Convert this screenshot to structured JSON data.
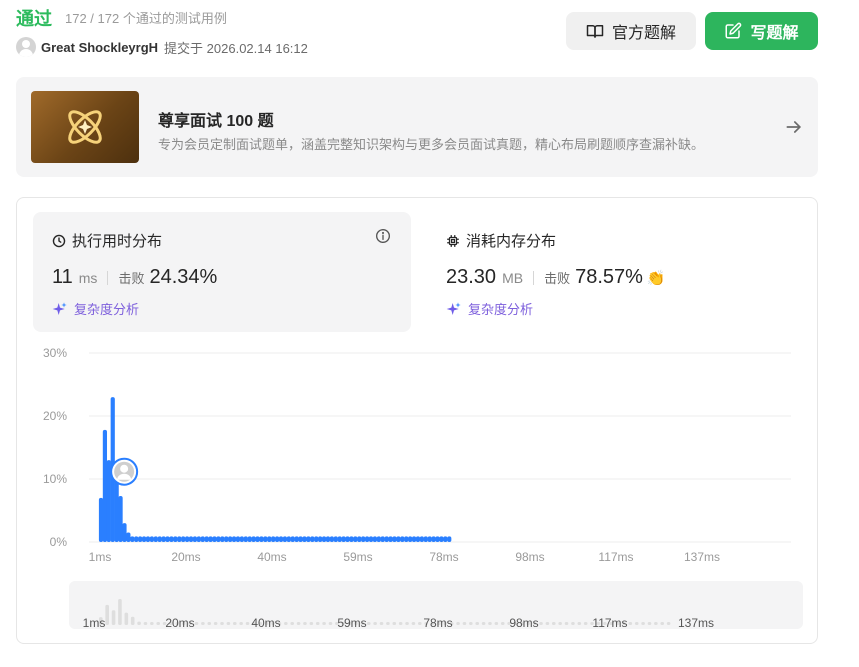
{
  "header": {
    "status": "通过",
    "cases": "172 / 172 个通过的测试用例",
    "username": "Great ShockleyrgH",
    "submitted": "提交于 2026.02.14 16:12",
    "official_btn": "官方题解",
    "write_btn": "写题解"
  },
  "promo": {
    "title": "尊享面试 100 题",
    "subtitle": "专为会员定制面试题单，涵盖完整知识架构与更多会员面试真题，精心布局刷题顺序查漏补缺。"
  },
  "runtime": {
    "title": "执行用时分布",
    "value": "11",
    "unit": "ms",
    "beat_label": "击败",
    "beat": "24.34%",
    "complexity": "复杂度分析"
  },
  "memory": {
    "title": "消耗内存分布",
    "value": "23.30",
    "unit": "MB",
    "beat_label": "击败",
    "beat": "78.57%",
    "complexity": "复杂度分析"
  },
  "colors": {
    "accent": "#2cbb5d",
    "bar": "#2a7fff",
    "purple": "#7d5fdc"
  },
  "chart_data": {
    "type": "bar",
    "ylabels": [
      "30%",
      "20%",
      "10%",
      "0%"
    ],
    "ylim": [
      0,
      30
    ],
    "xticks": [
      "1ms",
      "20ms",
      "40ms",
      "59ms",
      "78ms",
      "98ms",
      "117ms",
      "137ms"
    ],
    "xlim": [
      0,
      160
    ],
    "x": [
      1,
      2,
      3,
      4,
      5,
      6,
      7,
      8,
      9,
      10,
      11,
      12,
      13,
      14,
      15,
      16,
      17,
      18,
      19,
      20,
      21,
      22,
      23,
      24,
      25,
      26,
      27,
      28,
      29,
      30,
      31,
      32,
      33,
      34,
      35,
      36,
      37,
      38,
      39,
      40,
      41,
      42,
      43,
      44,
      45,
      46,
      47,
      48,
      49,
      50,
      51,
      52,
      53,
      54,
      55,
      56,
      57,
      58,
      59,
      60,
      61,
      62,
      63,
      64,
      65,
      66,
      67,
      68,
      69,
      70,
      71,
      72,
      73,
      74,
      75,
      76,
      77,
      78,
      79,
      80,
      81,
      82,
      83,
      84,
      85,
      86,
      87,
      88,
      89,
      90,
      91,
      92,
      93,
      94,
      95,
      96,
      97,
      98,
      99,
      100,
      101,
      102,
      103,
      104,
      105,
      106,
      107,
      108,
      109,
      110,
      111,
      112,
      113,
      114,
      115,
      116,
      117,
      118,
      119,
      120,
      121,
      122,
      123,
      124,
      125,
      126,
      127,
      128,
      129,
      130,
      131,
      132,
      133,
      134,
      135,
      136,
      137,
      138,
      139,
      140,
      141,
      142,
      143,
      144,
      145,
      146,
      147,
      148,
      149,
      150,
      151,
      152,
      153,
      154,
      155,
      156,
      157,
      158,
      159,
      160
    ],
    "values": [
      7.0,
      17.8,
      13.0,
      23.0,
      11.0,
      7.3,
      3.0,
      1.5,
      0.9,
      0.9,
      0.9,
      0.9,
      0.9,
      0.9,
      0.9,
      0.9,
      0.9,
      0.9,
      0.9,
      0.9,
      0.9,
      0.9,
      0.9,
      0.9,
      0.9,
      0.9,
      0.9,
      0.9,
      0.9,
      0.9,
      0.9,
      0.9,
      0.9,
      0.9,
      0.9,
      0.9,
      0.9,
      0.9,
      0.9,
      0.9,
      0.9,
      0.9,
      0.9,
      0.9,
      0.9,
      0.9,
      0.9,
      0.9,
      0.9,
      0.9,
      0.9,
      0.9,
      0.9,
      0.9,
      0.9,
      0.9,
      0.9,
      0.9,
      0.9,
      0.9,
      0.9,
      0.9,
      0.9,
      0.9,
      0.9,
      0.9,
      0.9,
      0.9,
      0.9,
      0.9,
      0.9,
      0.9,
      0.9,
      0.9,
      0.9,
      0.9,
      0.9,
      0.9,
      0.9,
      0.9,
      0.9,
      0.9,
      0.9,
      0.9,
      0.9,
      0.9,
      0.9,
      0.9,
      0.9,
      0.9
    ],
    "highlight_x": 11,
    "brush_xticks": [
      "1ms",
      "20ms",
      "40ms",
      "59ms",
      "78ms",
      "98ms",
      "117ms",
      "137ms"
    ]
  }
}
